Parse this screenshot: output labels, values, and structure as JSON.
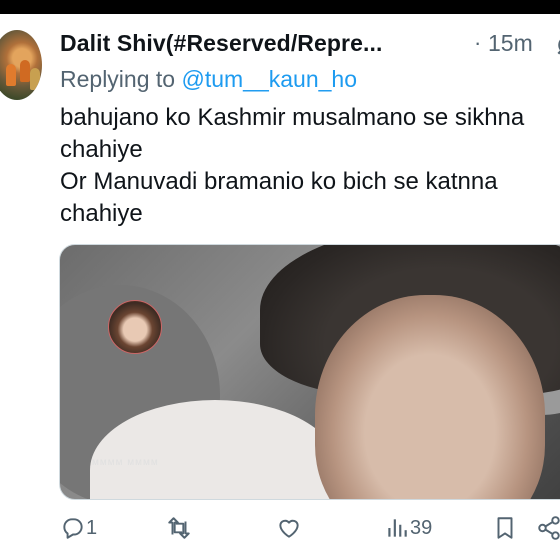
{
  "tweet": {
    "author_name": "Dalit Shiv(#Reserved/Repre...",
    "separator": "·",
    "time": "15m",
    "reply_prefix": "Replying to",
    "reply_handle": "@tum__kaun_ho",
    "text_lines": [
      "bahujano ko Kashmir musalmano se sikhna",
      "chahiye",
      "Or Manuvadi bramanio ko bich se katnna",
      "chahiye"
    ],
    "media": {
      "description_icon": "video-still",
      "watermark": "ᴍᴍᴍᴍ ᴍᴍᴍᴍ"
    },
    "actions": {
      "reply_count": "1",
      "retweet_count": "",
      "like_count": "",
      "view_count": "39"
    }
  },
  "icons": {
    "grok": "grok-icon",
    "reply": "reply-icon",
    "retweet": "retweet-icon",
    "like": "heart-icon",
    "views": "views-icon",
    "bookmark": "bookmark-icon",
    "share": "share-icon"
  },
  "colors": {
    "link": "#1d9bf0",
    "secondary": "#536471",
    "text": "#0f1419"
  }
}
